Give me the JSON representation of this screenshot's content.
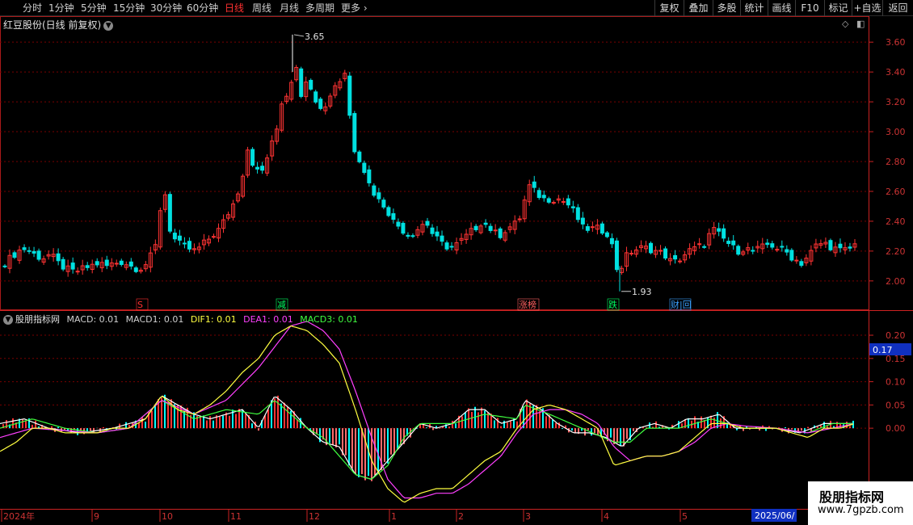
{
  "toolbar": {
    "periods": [
      "分时",
      "1分钟",
      "5分钟",
      "15分钟",
      "30分钟",
      "60分钟",
      "日线",
      "周线",
      "月线",
      "多周期",
      "更多"
    ],
    "active_period": "日线",
    "right_buttons": [
      "复权",
      "叠加",
      "多股",
      "统计",
      "画线",
      "F10",
      "标记",
      "+自选",
      "返回"
    ]
  },
  "stock": {
    "title": "红豆股份(日线 前复权)"
  },
  "price_axis": {
    "ticks": [
      "3.60",
      "3.40",
      "3.20",
      "3.00",
      "2.80",
      "2.60",
      "2.40",
      "2.20",
      "2.00"
    ],
    "high_label": "3.65",
    "low_label": "1.93"
  },
  "events": [
    {
      "label": "S",
      "color": "#ff3030"
    },
    {
      "label": "减",
      "color": "#00ff60"
    },
    {
      "label": "涨榜",
      "color": "#ff6060"
    },
    {
      "label": "跌",
      "color": "#00ff60"
    },
    {
      "label": "财|回",
      "color": "#3aa0ff"
    }
  ],
  "indicator": {
    "name": "股朋指标网",
    "items": [
      {
        "text": "MACD: 0.01",
        "color": "#d0d0d0"
      },
      {
        "text": "MACD1: 0.01",
        "color": "#d0d0d0"
      },
      {
        "text": "DIF1: 0.01",
        "color": "#ffff40"
      },
      {
        "text": "DEA1: 0.01",
        "color": "#ff40ff"
      },
      {
        "text": "MACD3: 0.01",
        "color": "#40ff40"
      }
    ],
    "axis_ticks": [
      "0.20",
      "0.15",
      "0.10",
      "0.05",
      "0.00"
    ],
    "current_value": "0.17"
  },
  "time_axis": {
    "labels": [
      "2024年",
      "9",
      "10",
      "11",
      "12",
      "1",
      "2",
      "3",
      "4",
      "5",
      "6"
    ],
    "current_date": "2025/06/"
  },
  "watermark": {
    "line1": "股朋指标网",
    "line2": "www.7gpzb.com"
  },
  "colors": {
    "up": "#ff3333",
    "down": "#00e0e0",
    "grid": "#7a0000",
    "axis": "#cc2222",
    "dif": "#ffff40",
    "dea": "#ff40ff",
    "macd3": "#40ff40",
    "macd_line": "#ffffff"
  },
  "chart_data": {
    "type": "candlestick",
    "price_range": [
      1.88,
      3.72
    ],
    "close_path": [
      [
        0,
        2.1
      ],
      [
        10,
        2.15
      ],
      [
        20,
        2.2
      ],
      [
        30,
        2.22
      ],
      [
        40,
        2.18
      ],
      [
        50,
        2.15
      ],
      [
        60,
        2.18
      ],
      [
        70,
        2.12
      ],
      [
        80,
        2.08
      ],
      [
        90,
        2.06
      ],
      [
        100,
        2.08
      ],
      [
        110,
        2.1
      ],
      [
        120,
        2.12
      ],
      [
        130,
        2.1
      ],
      [
        140,
        2.12
      ],
      [
        150,
        2.13
      ],
      [
        160,
        2.1
      ],
      [
        170,
        2.08
      ],
      [
        180,
        2.12
      ],
      [
        190,
        2.22
      ],
      [
        195,
        2.4
      ],
      [
        200,
        2.7
      ],
      [
        205,
        2.45
      ],
      [
        210,
        2.3
      ],
      [
        220,
        2.25
      ],
      [
        230,
        2.22
      ],
      [
        240,
        2.2
      ],
      [
        250,
        2.25
      ],
      [
        260,
        2.3
      ],
      [
        270,
        2.35
      ],
      [
        280,
        2.45
      ],
      [
        290,
        2.55
      ],
      [
        300,
        2.75
      ],
      [
        305,
        2.9
      ],
      [
        310,
        2.8
      ],
      [
        320,
        2.7
      ],
      [
        330,
        2.85
      ],
      [
        340,
        3.0
      ],
      [
        350,
        3.3
      ],
      [
        355,
        3.2
      ],
      [
        360,
        3.4
      ],
      [
        365,
        3.45
      ],
      [
        370,
        3.25
      ],
      [
        380,
        3.35
      ],
      [
        390,
        3.2
      ],
      [
        400,
        3.15
      ],
      [
        410,
        3.3
      ],
      [
        420,
        3.35
      ],
      [
        425,
        3.4
      ],
      [
        430,
        3.15
      ],
      [
        435,
        2.9
      ],
      [
        445,
        2.8
      ],
      [
        455,
        2.65
      ],
      [
        465,
        2.55
      ],
      [
        475,
        2.5
      ],
      [
        485,
        2.4
      ],
      [
        495,
        2.35
      ],
      [
        505,
        2.3
      ],
      [
        515,
        2.35
      ],
      [
        525,
        2.4
      ],
      [
        535,
        2.3
      ],
      [
        545,
        2.25
      ],
      [
        555,
        2.22
      ],
      [
        565,
        2.25
      ],
      [
        575,
        2.3
      ],
      [
        585,
        2.35
      ],
      [
        595,
        2.4
      ],
      [
        605,
        2.35
      ],
      [
        615,
        2.3
      ],
      [
        625,
        2.35
      ],
      [
        635,
        2.38
      ],
      [
        645,
        2.45
      ],
      [
        650,
        2.65
      ],
      [
        660,
        2.6
      ],
      [
        670,
        2.55
      ],
      [
        680,
        2.55
      ],
      [
        690,
        2.55
      ],
      [
        700,
        2.52
      ],
      [
        710,
        2.45
      ],
      [
        720,
        2.35
      ],
      [
        730,
        2.35
      ],
      [
        740,
        2.35
      ],
      [
        750,
        2.32
      ],
      [
        755,
        2.25
      ],
      [
        760,
        2.1
      ],
      [
        765,
        2.05
      ],
      [
        770,
        2.15
      ],
      [
        780,
        2.2
      ],
      [
        790,
        2.22
      ],
      [
        800,
        2.22
      ],
      [
        810,
        2.2
      ],
      [
        820,
        2.18
      ],
      [
        830,
        2.12
      ],
      [
        840,
        2.15
      ],
      [
        850,
        2.2
      ],
      [
        860,
        2.22
      ],
      [
        870,
        2.25
      ],
      [
        880,
        2.35
      ],
      [
        890,
        2.3
      ],
      [
        900,
        2.25
      ],
      [
        910,
        2.2
      ],
      [
        920,
        2.22
      ],
      [
        930,
        2.2
      ],
      [
        940,
        2.22
      ],
      [
        950,
        2.25
      ],
      [
        960,
        2.22
      ],
      [
        970,
        2.2
      ],
      [
        980,
        2.15
      ],
      [
        990,
        2.12
      ],
      [
        1000,
        2.18
      ],
      [
        1010,
        2.25
      ],
      [
        1020,
        2.25
      ],
      [
        1030,
        2.22
      ],
      [
        1040,
        2.2
      ],
      [
        1050,
        2.22
      ],
      [
        1058,
        2.25
      ]
    ],
    "indicator_range": [
      -0.17,
      0.24
    ],
    "dif_path": [
      [
        0,
        -0.05
      ],
      [
        20,
        -0.03
      ],
      [
        40,
        0.0
      ],
      [
        60,
        0.0
      ],
      [
        80,
        -0.01
      ],
      [
        100,
        -0.01
      ],
      [
        120,
        -0.01
      ],
      [
        140,
        0.0
      ],
      [
        160,
        0.0
      ],
      [
        180,
        0.02
      ],
      [
        200,
        0.07
      ],
      [
        220,
        0.04
      ],
      [
        240,
        0.03
      ],
      [
        260,
        0.05
      ],
      [
        280,
        0.08
      ],
      [
        300,
        0.12
      ],
      [
        320,
        0.15
      ],
      [
        340,
        0.2
      ],
      [
        360,
        0.22
      ],
      [
        380,
        0.21
      ],
      [
        400,
        0.18
      ],
      [
        420,
        0.14
      ],
      [
        440,
        0.04
      ],
      [
        460,
        -0.07
      ],
      [
        480,
        -0.13
      ],
      [
        500,
        -0.16
      ],
      [
        520,
        -0.14
      ],
      [
        540,
        -0.13
      ],
      [
        560,
        -0.13
      ],
      [
        580,
        -0.1
      ],
      [
        600,
        -0.07
      ],
      [
        620,
        -0.05
      ],
      [
        640,
        0.0
      ],
      [
        660,
        0.04
      ],
      [
        680,
        0.05
      ],
      [
        700,
        0.04
      ],
      [
        720,
        0.02
      ],
      [
        740,
        0.0
      ],
      [
        760,
        -0.08
      ],
      [
        780,
        -0.07
      ],
      [
        800,
        -0.06
      ],
      [
        820,
        -0.06
      ],
      [
        840,
        -0.05
      ],
      [
        860,
        -0.02
      ],
      [
        880,
        0.01
      ],
      [
        900,
        0.01
      ],
      [
        920,
        0.0
      ],
      [
        940,
        0.0
      ],
      [
        960,
        0.0
      ],
      [
        980,
        -0.01
      ],
      [
        1000,
        -0.02
      ],
      [
        1020,
        0.0
      ],
      [
        1040,
        0.0
      ],
      [
        1058,
        0.01
      ]
    ],
    "dea_path": [
      [
        0,
        -0.02
      ],
      [
        40,
        0.0
      ],
      [
        80,
        -0.005
      ],
      [
        120,
        -0.01
      ],
      [
        160,
        0.0
      ],
      [
        200,
        0.06
      ],
      [
        240,
        0.03
      ],
      [
        280,
        0.06
      ],
      [
        320,
        0.13
      ],
      [
        360,
        0.22
      ],
      [
        380,
        0.23
      ],
      [
        400,
        0.21
      ],
      [
        420,
        0.17
      ],
      [
        440,
        0.08
      ],
      [
        460,
        -0.02
      ],
      [
        480,
        -0.11
      ],
      [
        500,
        -0.15
      ],
      [
        520,
        -0.15
      ],
      [
        540,
        -0.14
      ],
      [
        560,
        -0.14
      ],
      [
        580,
        -0.12
      ],
      [
        600,
        -0.09
      ],
      [
        620,
        -0.06
      ],
      [
        640,
        -0.01
      ],
      [
        660,
        0.03
      ],
      [
        680,
        0.04
      ],
      [
        700,
        0.04
      ],
      [
        720,
        0.03
      ],
      [
        740,
        0.01
      ],
      [
        760,
        -0.04
      ],
      [
        780,
        -0.07
      ],
      [
        800,
        -0.06
      ],
      [
        820,
        -0.06
      ],
      [
        840,
        -0.05
      ],
      [
        860,
        -0.03
      ],
      [
        880,
        0.0
      ],
      [
        900,
        0.01
      ],
      [
        920,
        0.005
      ],
      [
        960,
        0.0
      ],
      [
        1000,
        -0.01
      ],
      [
        1030,
        0.0
      ],
      [
        1058,
        0.01
      ]
    ],
    "macd_path": [
      [
        0,
        0.01
      ],
      [
        30,
        0.02
      ],
      [
        60,
        0.0
      ],
      [
        100,
        -0.01
      ],
      [
        140,
        0.0
      ],
      [
        180,
        0.02
      ],
      [
        200,
        0.07
      ],
      [
        220,
        0.05
      ],
      [
        240,
        0.03
      ],
      [
        260,
        0.02
      ],
      [
        280,
        0.03
      ],
      [
        300,
        0.04
      ],
      [
        320,
        0.0
      ],
      [
        340,
        0.07
      ],
      [
        360,
        0.04
      ],
      [
        380,
        0.0
      ],
      [
        400,
        -0.03
      ],
      [
        420,
        -0.04
      ],
      [
        440,
        -0.1
      ],
      [
        460,
        -0.11
      ],
      [
        480,
        -0.07
      ],
      [
        500,
        -0.03
      ],
      [
        520,
        0.01
      ],
      [
        540,
        0.0
      ],
      [
        560,
        0.01
      ],
      [
        580,
        0.04
      ],
      [
        600,
        0.04
      ],
      [
        620,
        0.01
      ],
      [
        640,
        0.02
      ],
      [
        650,
        0.06
      ],
      [
        670,
        0.04
      ],
      [
        690,
        0.01
      ],
      [
        710,
        -0.01
      ],
      [
        730,
        -0.01
      ],
      [
        750,
        -0.02
      ],
      [
        770,
        -0.04
      ],
      [
        790,
        0.0
      ],
      [
        810,
        0.01
      ],
      [
        830,
        0.0
      ],
      [
        850,
        0.02
      ],
      [
        870,
        0.02
      ],
      [
        890,
        0.03
      ],
      [
        910,
        0.0
      ],
      [
        930,
        0.0
      ],
      [
        960,
        0.0
      ],
      [
        990,
        -0.01
      ],
      [
        1020,
        0.01
      ],
      [
        1058,
        0.01
      ]
    ],
    "macd3_path": [
      [
        0,
        0.0
      ],
      [
        40,
        0.02
      ],
      [
        80,
        0.0
      ],
      [
        120,
        -0.01
      ],
      [
        160,
        0.0
      ],
      [
        200,
        0.06
      ],
      [
        240,
        0.02
      ],
      [
        280,
        0.04
      ],
      [
        320,
        0.03
      ],
      [
        340,
        0.06
      ],
      [
        360,
        0.03
      ],
      [
        380,
        0.0
      ],
      [
        400,
        -0.02
      ],
      [
        420,
        -0.06
      ],
      [
        440,
        -0.1
      ],
      [
        460,
        -0.11
      ],
      [
        480,
        -0.08
      ],
      [
        500,
        -0.02
      ],
      [
        520,
        0.01
      ],
      [
        560,
        0.01
      ],
      [
        600,
        0.03
      ],
      [
        640,
        0.02
      ],
      [
        650,
        0.05
      ],
      [
        680,
        0.03
      ],
      [
        720,
        0.0
      ],
      [
        760,
        -0.03
      ],
      [
        780,
        -0.03
      ],
      [
        800,
        0.0
      ],
      [
        840,
        0.0
      ],
      [
        880,
        0.02
      ],
      [
        920,
        0.0
      ],
      [
        960,
        0.0
      ],
      [
        1000,
        -0.01
      ],
      [
        1030,
        0.01
      ],
      [
        1058,
        0.01
      ]
    ]
  }
}
